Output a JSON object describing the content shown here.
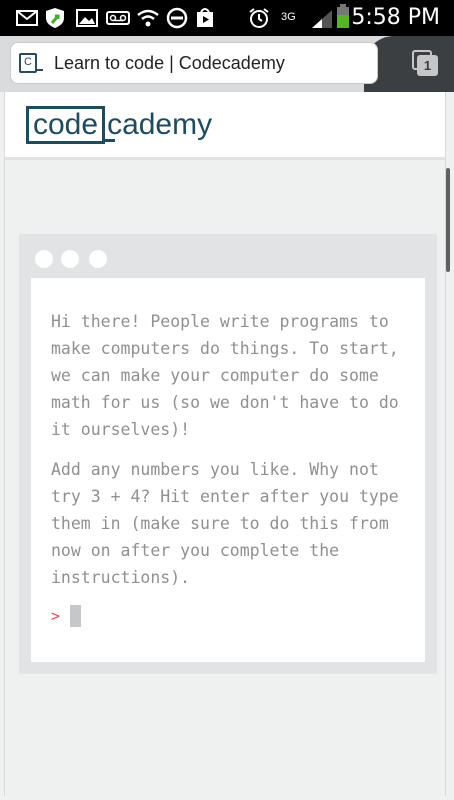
{
  "status_bar": {
    "time": "5:58 PM",
    "network": "3G",
    "icons": [
      "mail-icon",
      "shield-icon",
      "image-icon",
      "voicemail-icon",
      "wifi-icon",
      "do-not-disturb-icon",
      "play-store-icon",
      "alarm-icon",
      "signal-icon",
      "battery-icon"
    ]
  },
  "browser": {
    "tab_title": "Learn to code | Codecademy",
    "tab_count": "1",
    "favicon_letter": "C"
  },
  "site": {
    "logo_boxed": "code",
    "logo_rest": "cademy"
  },
  "terminal": {
    "paragraph_1": "Hi there! People write programs to make computers do things. To start, we can make your computer do some math for us (so we don't have to do it ourselves)!",
    "paragraph_2": "Add any numbers you like. Why not try 3 + 4? Hit enter after you type them in (make sure to do this from now on after you complete the instructions).",
    "prompt": ">"
  },
  "colors": {
    "brand": "#204b5e",
    "prompt": "#e4474f",
    "page_bg": "#eff0f0"
  }
}
